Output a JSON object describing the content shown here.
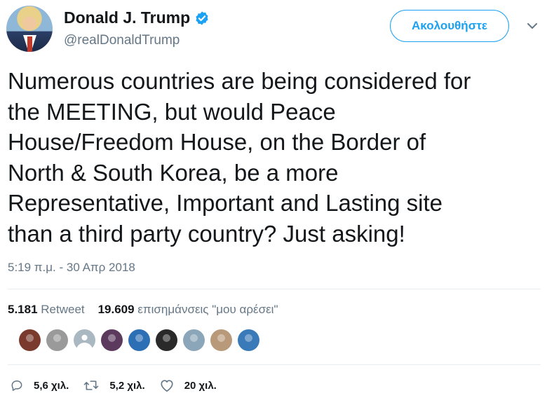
{
  "user": {
    "name": "Donald J. Trump",
    "handle": "@realDonaldTrump",
    "verified": true
  },
  "follow_button": {
    "label": "Ακολουθήστε"
  },
  "tweet": {
    "lines": [
      "Numerous countries are being considered for",
      "the MEETING, but would Peace",
      "House/Freedom House, on the Border of",
      "North & South Korea, be a more",
      "Representative, Important and Lasting site",
      "than a third party country? Just asking!"
    ],
    "timestamp": "5:19 π.μ. - 30 Απρ 2018"
  },
  "stats": {
    "retweets_count": "5.181",
    "retweets_label": "Retweet",
    "likes_count": "19.609",
    "likes_label": "επισημάνσεις \"μου αρέσει\""
  },
  "likers": [
    {
      "icon": "liker-avatar",
      "color": "#7a3b2e"
    },
    {
      "icon": "liker-avatar",
      "color": "#9a9a9a"
    },
    {
      "icon": "default-avatar-icon",
      "color": "#aab8c2"
    },
    {
      "icon": "liker-avatar",
      "color": "#5b3a5e"
    },
    {
      "icon": "liker-avatar",
      "color": "#2d6fb5"
    },
    {
      "icon": "liker-avatar",
      "color": "#2a2a2a"
    },
    {
      "icon": "liker-avatar",
      "color": "#8aa6b8"
    },
    {
      "icon": "liker-avatar",
      "color": "#b89a7a"
    },
    {
      "icon": "liker-avatar",
      "color": "#3a7ab8"
    }
  ],
  "actions": {
    "replies": "5,6 χιλ.",
    "retweets": "5,2 χιλ.",
    "likes": "20 χιλ."
  },
  "colors": {
    "accent": "#1da1f2",
    "muted": "#657786",
    "text": "#14171a"
  }
}
